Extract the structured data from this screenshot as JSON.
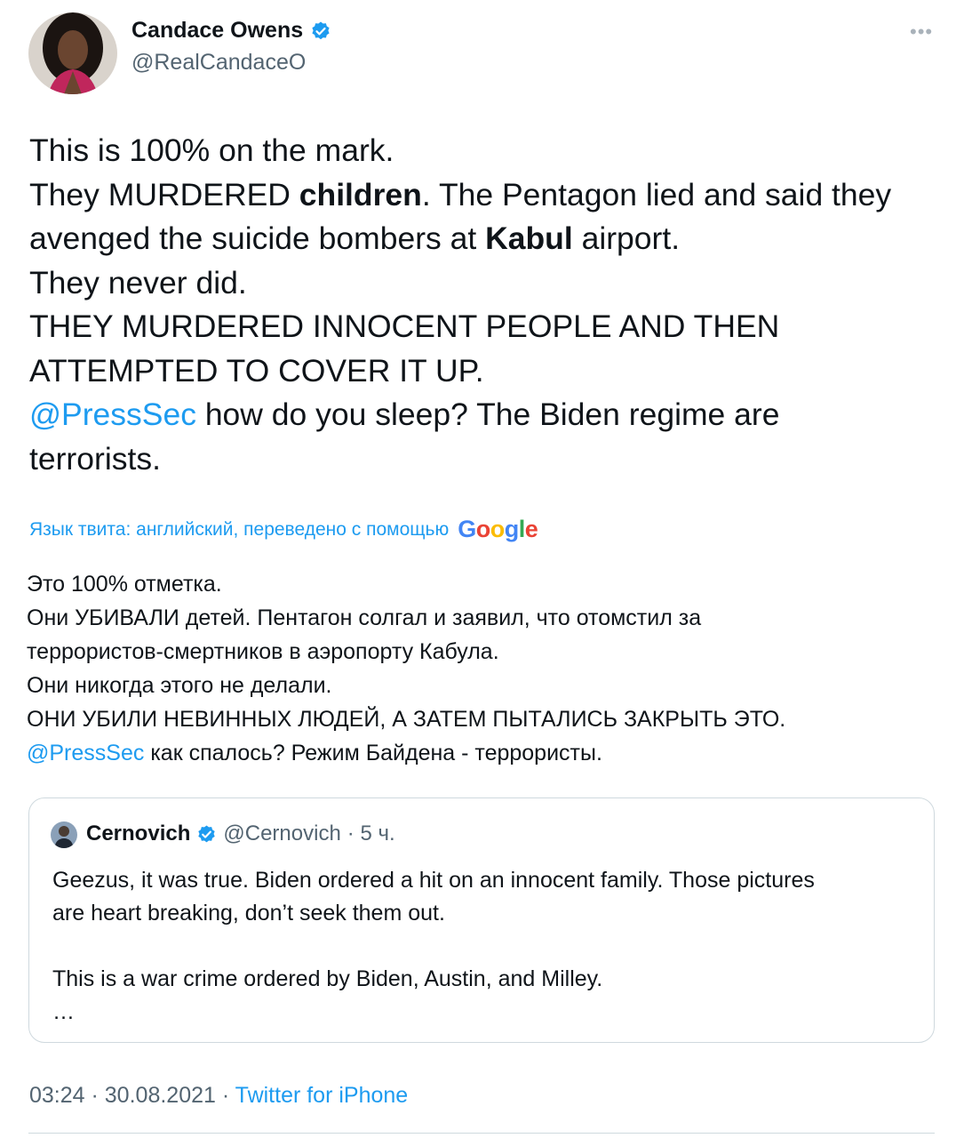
{
  "author": {
    "name": "Candace Owens",
    "handle": "@RealCandaceO",
    "verified": true
  },
  "tweet": {
    "lines": [
      {
        "segments": [
          {
            "text": "This is 100% on the mark."
          }
        ]
      },
      {
        "segments": [
          {
            "text": "They MURDERED "
          },
          {
            "text": "children",
            "bold": true
          },
          {
            "text": ". The Pentagon lied and said they"
          }
        ]
      },
      {
        "segments": [
          {
            "text": "avenged the suicide bombers at "
          },
          {
            "text": "Kabul",
            "bold": true
          },
          {
            "text": " airport."
          }
        ]
      },
      {
        "segments": [
          {
            "text": "They never did."
          }
        ]
      },
      {
        "segments": [
          {
            "text": "THEY MURDERED INNOCENT PEOPLE AND THEN"
          }
        ]
      },
      {
        "segments": [
          {
            "text": "ATTEMPTED TO COVER IT UP."
          }
        ]
      },
      {
        "segments": [
          {
            "text": "@PressSec",
            "mention": true
          },
          {
            "text": " how do you sleep? The Biden regime are"
          }
        ]
      },
      {
        "segments": [
          {
            "text": "terrorists."
          }
        ]
      }
    ]
  },
  "translation": {
    "note": "Язык твита: английский, переведено с помощью",
    "provider": "Google",
    "lines": [
      {
        "segments": [
          {
            "text": "Это 100% отметка."
          }
        ]
      },
      {
        "segments": [
          {
            "text": " Они УБИВАЛИ детей. Пентагон солгал и заявил, что отомстил за"
          }
        ]
      },
      {
        "segments": [
          {
            "text": "террористов-смертников в аэропорту Кабула."
          }
        ]
      },
      {
        "segments": [
          {
            "text": " Они никогда этого не делали."
          }
        ]
      },
      {
        "segments": [
          {
            "text": " ОНИ УБИЛИ НЕВИННЫХ ЛЮДЕЙ, А ЗАТЕМ ПЫТАЛИСЬ ЗАКРЫТЬ ЭТО."
          }
        ]
      },
      {
        "segments": [
          {
            "text": "@PressSec",
            "mention": true
          },
          {
            "text": " как спалось? Режим Байдена - террористы."
          }
        ]
      }
    ]
  },
  "quote": {
    "name": "Cernovich",
    "handle": "@Cernovich",
    "time": "· 5 ч.",
    "verified": true,
    "lines": [
      "Geezus, it was true. Biden ordered a hit on an innocent family. Those pictures",
      "are heart breaking, don’t seek them out.",
      "",
      "This is a war crime ordered by Biden, Austin, and Milley.",
      "…"
    ]
  },
  "meta": {
    "time": "03:24",
    "sep1": " · ",
    "date": "30.08.2021",
    "sep2": " · ",
    "source": "Twitter for iPhone"
  },
  "icons": {
    "more": "more-horizontal-icon",
    "verified": "verified-badge-icon"
  },
  "colors": {
    "link": "#1d9bf0",
    "text": "#0f1419",
    "muted": "#536471",
    "border": "#cfd9de"
  }
}
